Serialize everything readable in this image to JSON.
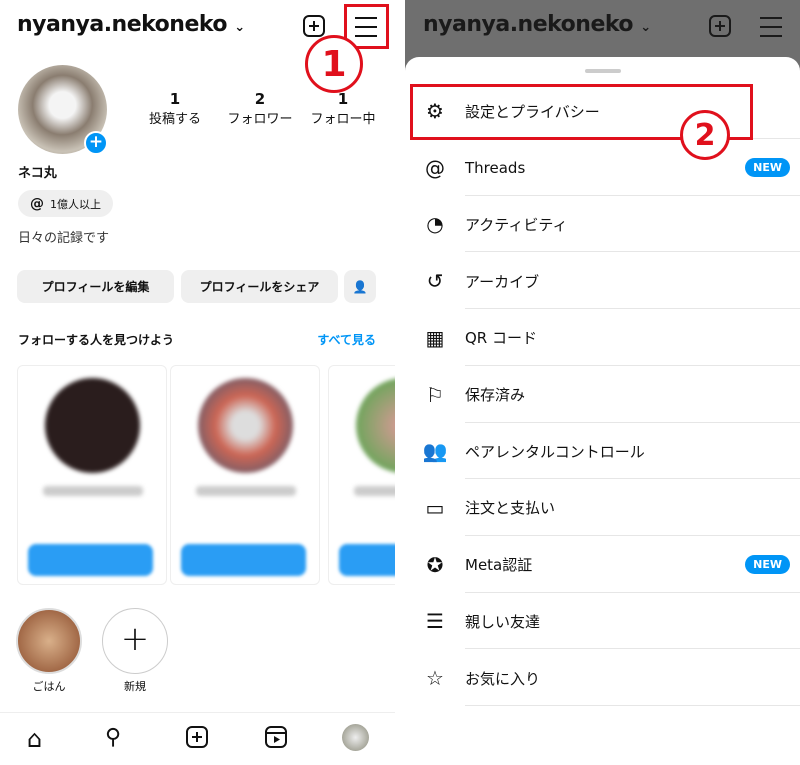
{
  "profile": {
    "username": "nyanya.nekoneko",
    "display_name": "ネコ丸",
    "threads_badge": "1億人以上",
    "bio": "日々の記録です",
    "stats": [
      {
        "value": "1",
        "label": "投稿する"
      },
      {
        "value": "2",
        "label": "フォロワー"
      },
      {
        "value": "1",
        "label": "フォロー中"
      }
    ],
    "edit_button": "プロフィールを編集",
    "share_button": "プロフィールをシェア",
    "suggest_title": "フォローする人を見つけよう",
    "see_all": "すべて見る",
    "highlights": [
      {
        "label": "ごはん"
      },
      {
        "label": "新規"
      }
    ]
  },
  "annotations": {
    "step1": "1",
    "step2": "2"
  },
  "menu": {
    "items": [
      {
        "label": "設定とプライバシー",
        "icon": "settings-icon"
      },
      {
        "label": "Threads",
        "icon": "threads-icon",
        "badge": "NEW"
      },
      {
        "label": "アクティビティ",
        "icon": "activity-icon"
      },
      {
        "label": "アーカイブ",
        "icon": "archive-icon"
      },
      {
        "label": "QR コード",
        "icon": "qr-code-icon"
      },
      {
        "label": "保存済み",
        "icon": "bookmark-icon"
      },
      {
        "label": "ペアレンタルコントロール",
        "icon": "parental-control-icon"
      },
      {
        "label": "注文と支払い",
        "icon": "credit-card-icon"
      },
      {
        "label": "Meta認証",
        "icon": "verified-icon",
        "badge": "NEW"
      },
      {
        "label": "親しい友達",
        "icon": "close-friends-icon"
      },
      {
        "label": "お気に入り",
        "icon": "star-icon"
      }
    ]
  },
  "colors": {
    "accent": "#0095f6",
    "annotation": "#e0101c",
    "overlay": "#6f6f6f"
  }
}
